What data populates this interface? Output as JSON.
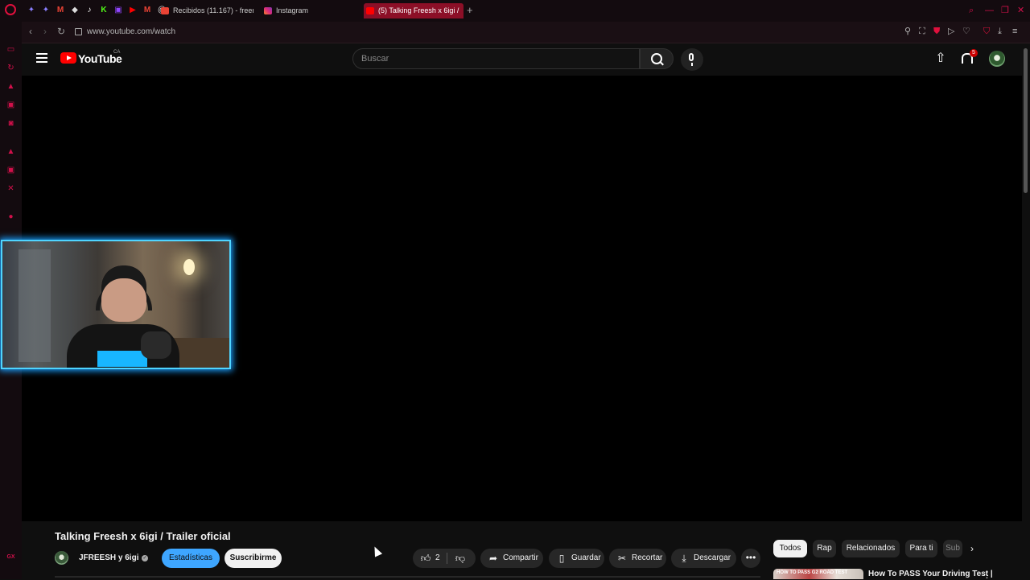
{
  "browser": {
    "tabs": [
      {
        "label": "Recibidos (11.167) - freer",
        "icon": "gmail-icon"
      },
      {
        "label": "Instagram",
        "icon": "instagram-icon"
      },
      {
        "label": "(5) Talking Freesh x 6igi /",
        "icon": "youtube-icon"
      }
    ],
    "pinned_icons": [
      "messenger-icon",
      "messenger-icon",
      "gmail-icon",
      "diamond-icon",
      "tiktok-icon",
      "kick-icon",
      "twitch-icon",
      "youtube-icon",
      "gmail-icon",
      "threads-icon"
    ],
    "url": "www.youtube.com/watch",
    "sidebar_icons": [
      "inbox-icon",
      "history-icon",
      "wallet-icon",
      "twitch-icon",
      "messenger-icon",
      "arc-icon",
      "twitch-icon",
      "x-icon",
      "music-icon"
    ],
    "sidebar_bottom": "GX",
    "accent_color": "#e0103d"
  },
  "youtube": {
    "wordmark": "YouTube",
    "country": "CA",
    "search_placeholder": "Buscar",
    "notifications_count": "5"
  },
  "video": {
    "title": "Talking Freesh x 6igi / Trailer oficial",
    "channel": "JFREESH y 6igi",
    "stats_label": "Estadísticas",
    "subscribe_label": "Suscribirme",
    "like_count": "2",
    "share_label": "Compartir",
    "save_label": "Guardar",
    "clip_label": "Recortar",
    "download_label": "Descargar"
  },
  "chips": [
    "Todos",
    "Rap",
    "Relacionados",
    "Para ti",
    "Sub"
  ],
  "recommendation": {
    "title": "How To PASS Your Driving Test |",
    "thumb_text": "HOW TO PASS G2 ROAD TEST"
  }
}
